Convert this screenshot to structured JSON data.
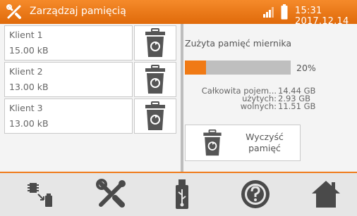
{
  "header": {
    "title": "Zarządzaj pamięcią",
    "time": "15:31 2017.12.14",
    "title_icon": "tools-icon",
    "signal_icon": "signal-icon",
    "battery_icon": "battery-icon"
  },
  "clients": [
    {
      "name": "Klient 1",
      "size": "15.00 kB"
    },
    {
      "name": "Klient 2",
      "size": "13.00 kB"
    },
    {
      "name": "Klient 3",
      "size": "13.00 kB"
    }
  ],
  "memory": {
    "used_title": "Zużyta pamięć miernika",
    "used_fraction": 0.2,
    "percent_label": "20%",
    "total_label": "Całkowita pojem...",
    "total_value": "14.44 GB",
    "used_label": "użytych:",
    "used_value": "2.93 GB",
    "free_label": "wolnych:",
    "free_value": "11.51 GB",
    "clear_line1": "Wyczyść",
    "clear_line2": "pamięć"
  },
  "toolbar": [
    "memory-transfer-icon",
    "settings-tools-icon",
    "usb-icon",
    "help-icon",
    "home-icon"
  ],
  "colors": {
    "accent": "#f07a15",
    "header": "#e8731a",
    "bar_bg": "#bfbfbf"
  }
}
